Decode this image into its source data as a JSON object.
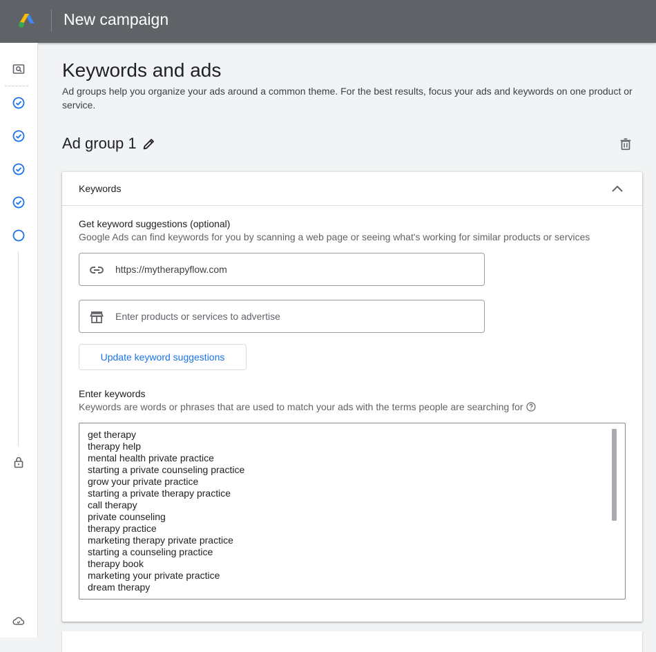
{
  "header": {
    "logo_icon": "google-ads-logo",
    "title": "New campaign",
    "background": "#5f6368"
  },
  "siderail": {
    "steps": [
      {
        "icon": "search-campaign-icon",
        "status": "type"
      },
      {
        "icon": "check-circle-icon",
        "status": "done"
      },
      {
        "icon": "check-circle-icon",
        "status": "done"
      },
      {
        "icon": "check-circle-icon",
        "status": "done"
      },
      {
        "icon": "check-circle-icon",
        "status": "done"
      },
      {
        "icon": "empty-circle-icon",
        "status": "current"
      },
      {
        "icon": "lock-icon",
        "status": "locked"
      }
    ],
    "footer_icon": "cloud-sync-icon",
    "accent": "#1a73e8"
  },
  "page": {
    "title": "Keywords and ads",
    "description": "Ad groups help you organize your ads around a common theme. For the best results, focus your ads and keywords on one product or service."
  },
  "ad_group": {
    "name": "Ad group 1",
    "edit_icon": "pencil-icon",
    "delete_icon": "trash-icon"
  },
  "keywords_card": {
    "header": "Keywords",
    "collapse_icon": "chevron-up-icon",
    "suggestions": {
      "label": "Get keyword suggestions (optional)",
      "help": "Google Ads can find keywords for you by scanning a web page or seeing what's working for similar products or services",
      "url_field": {
        "icon": "link-icon",
        "value": "https://mytherapyflow.com"
      },
      "products_field": {
        "icon": "store-icon",
        "placeholder": "Enter products or services to advertise"
      },
      "update_button": "Update keyword suggestions"
    },
    "enter_keywords": {
      "label": "Enter keywords",
      "help": "Keywords are words or phrases that are used to match your ads with the terms people are searching for",
      "help_icon": "help-circle-icon",
      "keywords": [
        "get therapy",
        "therapy help",
        "mental health private practice",
        "starting a private counseling practice",
        "grow your private practice",
        "starting a private therapy practice",
        "call therapy",
        "private counseling",
        "therapy practice",
        "marketing therapy private practice",
        "starting a counseling practice",
        "therapy book",
        "marketing your private practice",
        "dream therapy"
      ]
    }
  }
}
